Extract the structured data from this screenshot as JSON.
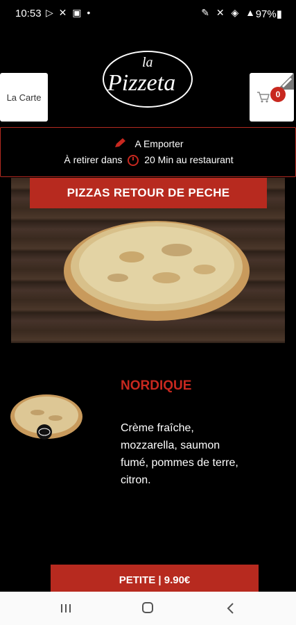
{
  "status_bar": {
    "time": "10:53",
    "left_icons": "▷ ✕ ▣ •",
    "right_icons": "✎ ✕ ◈ ▲",
    "battery": "97%▮"
  },
  "header": {
    "menu_label": "La Carte",
    "logo_text_top": "la",
    "logo_text_main": "Pizzeta",
    "cart_count": "0"
  },
  "order_info": {
    "mode": "A Emporter",
    "pickup_prefix": "À retirer dans",
    "pickup_suffix": "20 Min au restaurant"
  },
  "category": {
    "title": "PIZZAS RETOUR DE PECHE"
  },
  "product": {
    "name": "NORDIQUE",
    "description": "Crème fraîche, mozzarella, saumon fumé, pommes de terre, citron.",
    "size_button": "PETITE | 9.90€"
  },
  "colors": {
    "accent": "#b72a1f",
    "background": "#000000"
  },
  "nav": {
    "icons": [
      "recents-icon",
      "home-icon",
      "back-icon"
    ]
  }
}
